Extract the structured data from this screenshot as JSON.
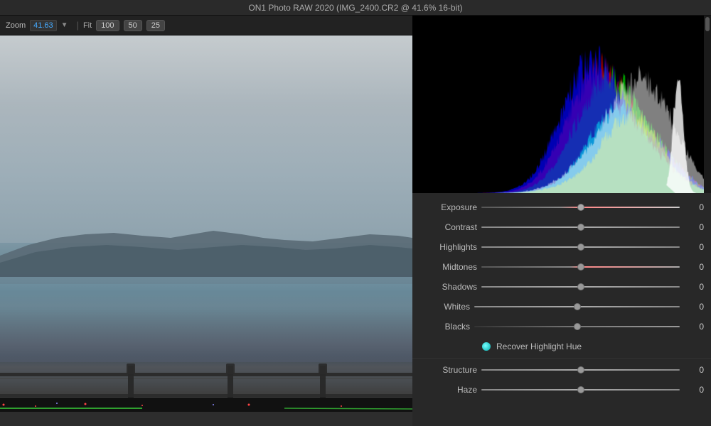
{
  "titlebar": {
    "title": "ON1 Photo RAW 2020 (IMG_2400.CR2 @ 41.6% 16-bit)"
  },
  "toolbar": {
    "zoom_label": "Zoom",
    "zoom_value": "41.63",
    "btn1": "100",
    "btn2": "50",
    "btn3": "25"
  },
  "controls": {
    "exposure_label": "Exposure",
    "exposure_value": "0",
    "contrast_label": "Contrast",
    "contrast_value": "0",
    "highlights_label": "Highlights",
    "highlights_value": "0",
    "midtones_label": "Midtones",
    "midtones_value": "0",
    "shadows_label": "Shadows",
    "shadows_value": "0",
    "whites_label": "Whites",
    "whites_value": "0",
    "blacks_label": "Blacks",
    "blacks_value": "0",
    "recover_label": "Recover Highlight Hue",
    "structure_label": "Structure",
    "structure_value": "0",
    "haze_label": "Haze",
    "haze_value": "0"
  },
  "colors": {
    "accent": "#4aaeff",
    "highlight_red": "#ff4444",
    "bg_dark": "#1a1a1a",
    "bg_panel": "#282828",
    "slider_track": "#888888"
  }
}
